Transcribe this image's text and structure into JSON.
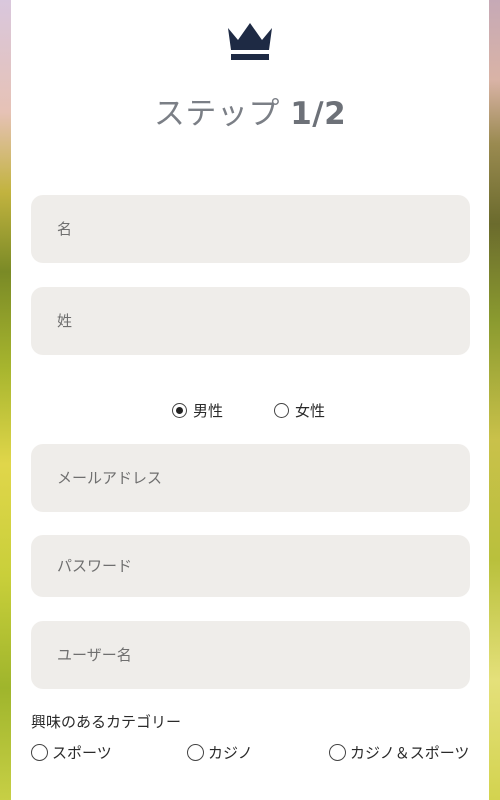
{
  "header": {
    "title_prefix": "ステップ",
    "title_step": "1/2",
    "logo_icon": "crown-icon",
    "logo_color": "#1e2a44"
  },
  "form": {
    "first_name_placeholder": "名",
    "last_name_placeholder": "姓",
    "gender_options": [
      {
        "label": "男性",
        "selected": true
      },
      {
        "label": "女性",
        "selected": false
      }
    ],
    "email_placeholder": "メールアドレス",
    "password_placeholder": "パスワード",
    "username_placeholder": "ユーザー名",
    "interest_label": "興味のあるカテゴリー",
    "interest_options": [
      {
        "label": "スポーツ",
        "selected": false
      },
      {
        "label": "カジノ",
        "selected": false
      },
      {
        "label": "カジノ＆スポーツ",
        "selected": false
      }
    ]
  },
  "colors": {
    "field_background": "#efedea",
    "title_text": "#7b7f86",
    "body_text": "#2a2a2a"
  }
}
